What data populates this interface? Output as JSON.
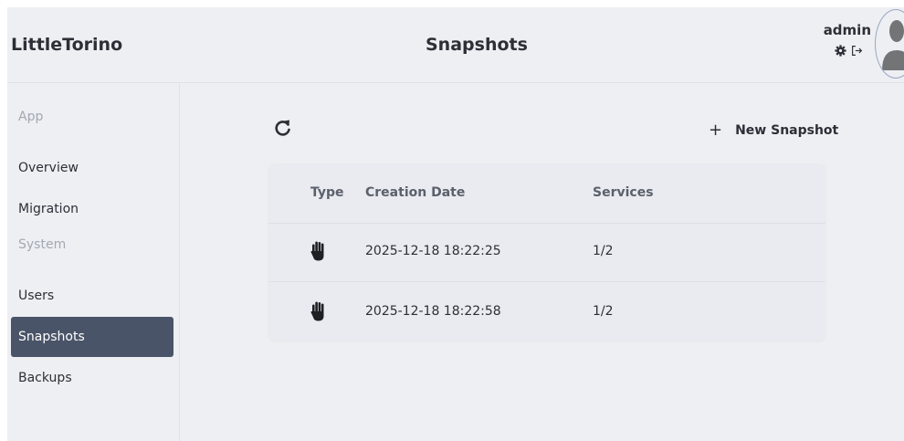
{
  "header": {
    "brand": "LittleTorino",
    "page_title": "Snapshots",
    "user": {
      "name": "admin",
      "icons": [
        "gear-icon",
        "logout-icon",
        "avatar"
      ]
    }
  },
  "sidebar": {
    "sections": [
      {
        "label": "App",
        "items": [
          {
            "label": "Overview"
          },
          {
            "label": "Migration"
          }
        ]
      },
      {
        "label": "System",
        "items": [
          {
            "label": "Users"
          },
          {
            "label": "Snapshots",
            "active": true
          },
          {
            "label": "Backups"
          }
        ]
      }
    ]
  },
  "main": {
    "refresh_icon": "refresh-icon",
    "new_snapshot_label": "New Snapshot",
    "new_snapshot_icon": "+",
    "table": {
      "columns": [
        "Type",
        "Creation Date",
        "Services"
      ],
      "rows": [
        {
          "type_icon": "hand-icon",
          "creation_date": "2025-12-18 18:22:25",
          "services": "1/2"
        },
        {
          "type_icon": "hand-icon",
          "creation_date": "2025-12-18 18:22:58",
          "services": "1/2"
        }
      ]
    }
  },
  "colors": {
    "background": "#edeff3",
    "active_item": "#4a5468",
    "text": "#2c2f36",
    "muted": "#a3a8b2"
  }
}
